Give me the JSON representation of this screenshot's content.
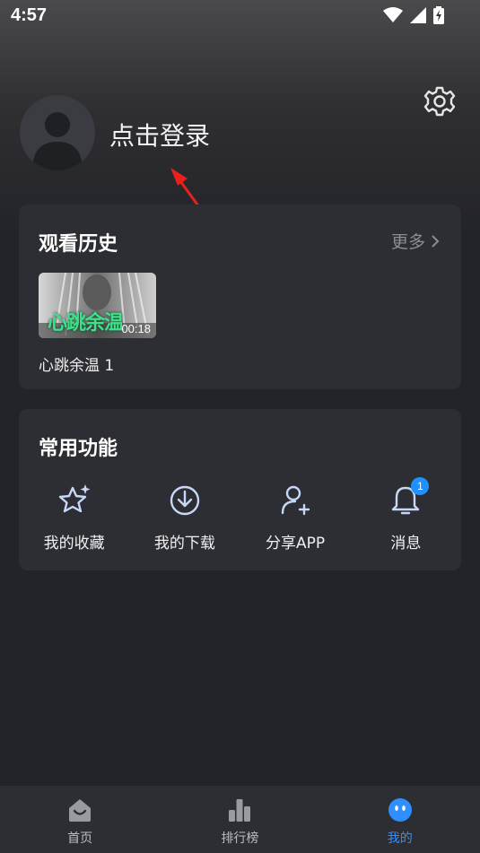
{
  "status_bar": {
    "time": "4:57"
  },
  "header": {
    "login_text": "点击登录"
  },
  "history": {
    "title": "观看历史",
    "more": "更多",
    "items": [
      {
        "thumb_title": "心跳余温",
        "duration": "00:18",
        "caption": "心跳余温 1"
      }
    ]
  },
  "functions": {
    "title": "常用功能",
    "items": [
      {
        "label": "我的收藏",
        "icon": "star-icon"
      },
      {
        "label": "我的下载",
        "icon": "download-icon"
      },
      {
        "label": "分享APP",
        "icon": "share-user-icon"
      },
      {
        "label": "消息",
        "icon": "bell-icon",
        "badge": "1"
      }
    ]
  },
  "bottom_nav": {
    "items": [
      {
        "label": "首页",
        "icon": "home-icon"
      },
      {
        "label": "排行榜",
        "icon": "ranking-icon"
      },
      {
        "label": "我的",
        "icon": "profile-face-icon",
        "active": true
      }
    ]
  },
  "colors": {
    "accent": "#2f8fff",
    "card": "#2d2e33",
    "background": "#232429",
    "annotation_arrow": "#e8201e"
  }
}
